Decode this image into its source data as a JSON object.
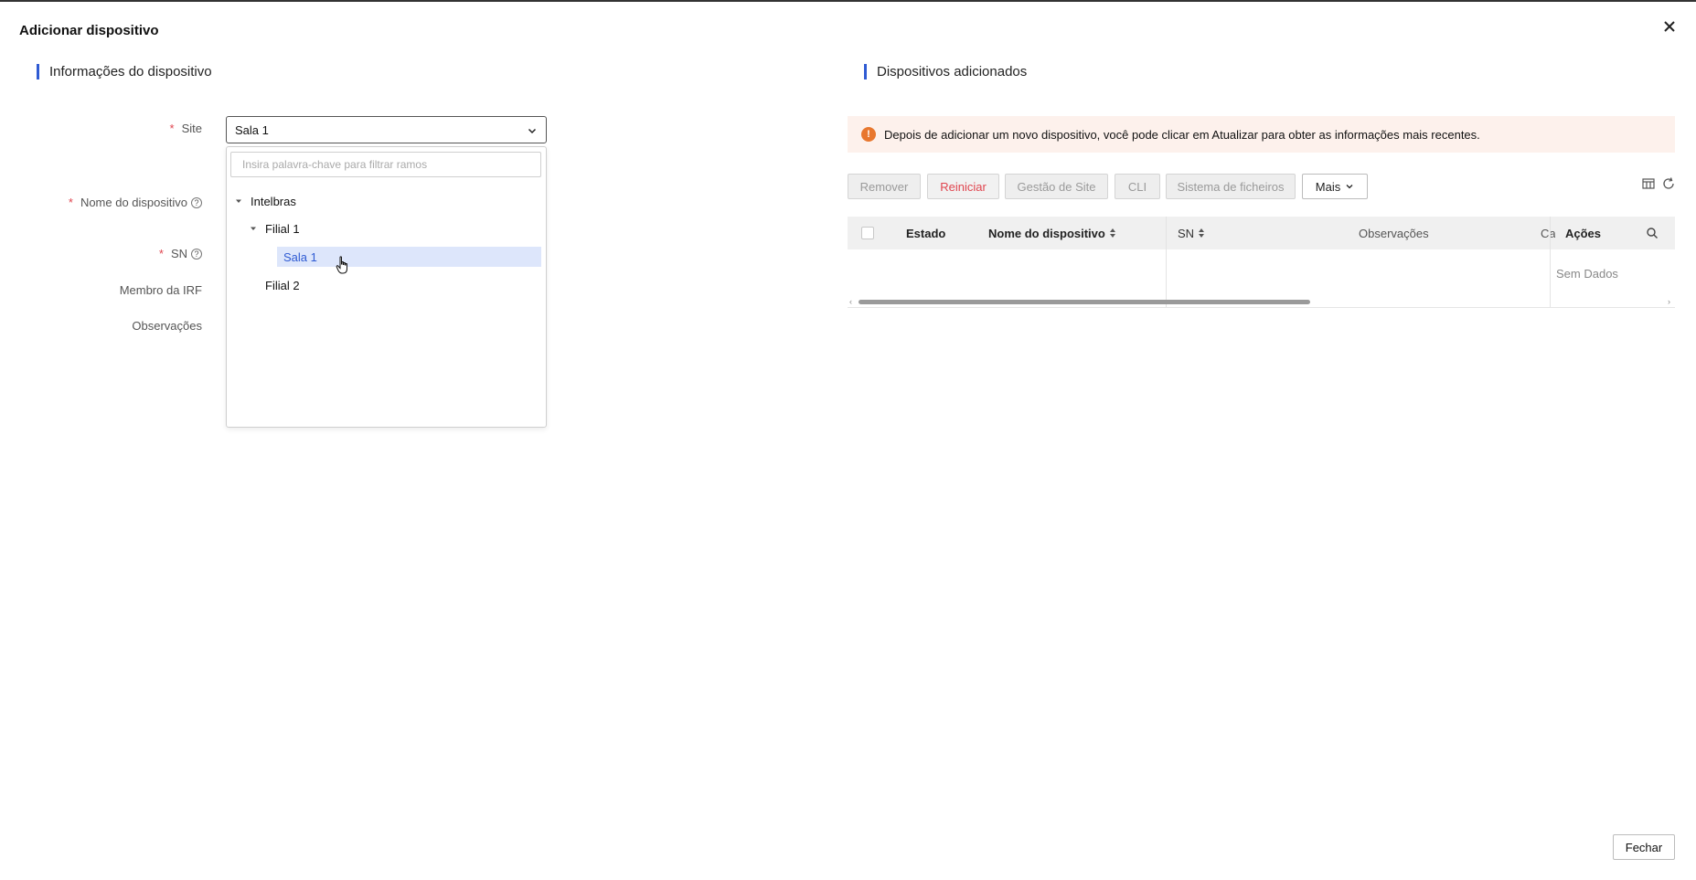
{
  "modal": {
    "title": "Adicionar dispositivo",
    "close_label": "Fechar"
  },
  "left": {
    "section_title": "Informações do dispositivo",
    "fields": {
      "site": "Site",
      "device_name": "Nome do dispositivo",
      "sn": "SN",
      "irf_member": "Membro da IRF",
      "notes": "Observações"
    },
    "site_select": {
      "value": "Sala 1",
      "filter_placeholder": "Insira palavra-chave para filtrar ramos"
    },
    "tree": {
      "root": "Intelbras",
      "branch1": "Filial 1",
      "leaf1": "Sala 1",
      "branch2": "Filial 2"
    }
  },
  "right": {
    "section_title": "Dispositivos adicionados",
    "alert_text": "Depois de adicionar um novo dispositivo, você pode clicar em Atualizar para obter as informações mais recentes.",
    "toolbar": {
      "remove": "Remover",
      "restart": "Reiniciar",
      "site_management": "Gestão de Site",
      "cli": "CLI",
      "file_system": "Sistema de ficheiros",
      "more": "Mais"
    },
    "table": {
      "columns": {
        "status": "Estado",
        "device_name": "Nome do dispositivo",
        "sn": "SN",
        "notes": "Observações",
        "truncated": "Ca",
        "actions": "Ações"
      },
      "empty_text": "Sem Dados"
    }
  },
  "colors": {
    "accent": "#2f5bd3",
    "danger": "#e0454f",
    "warning": "#e8772e"
  }
}
